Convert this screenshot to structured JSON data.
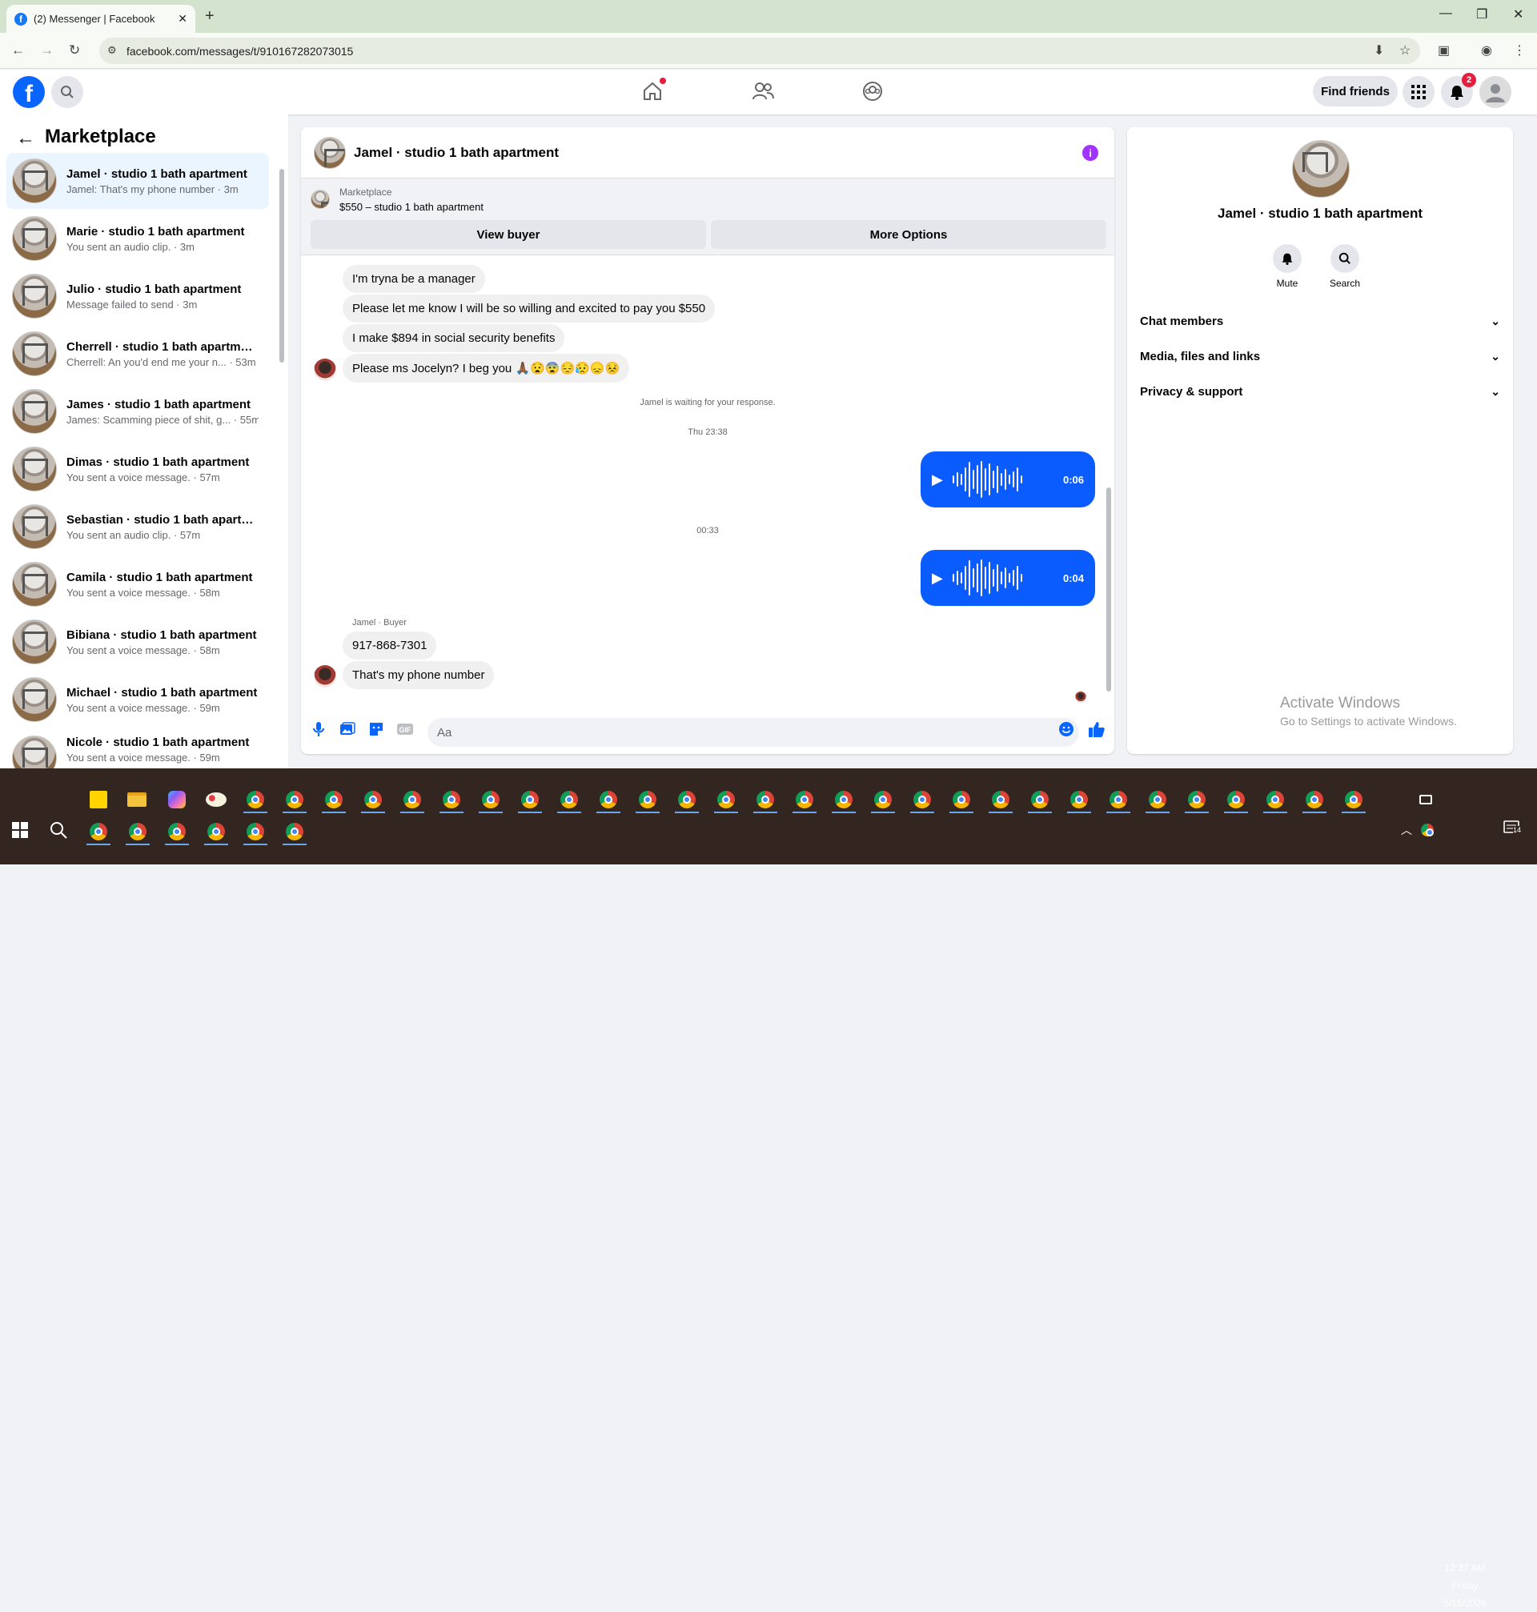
{
  "browser": {
    "tab_title": "(2) Messenger | Facebook",
    "tab_favicon": "f",
    "url": "facebook.com/messages/t/910167282073015"
  },
  "header": {
    "find_friends_label": "Find friends",
    "notifications_count": "2"
  },
  "sidebar": {
    "title": "Marketplace",
    "conversations": [
      {
        "title": "Jamel · studio 1 bath apartment",
        "snippet": "Jamel: That's my phone number · 3m"
      },
      {
        "title": "Marie · studio 1 bath apartment",
        "snippet": "You sent an audio clip. · 3m"
      },
      {
        "title": "Julio · studio 1 bath apartment",
        "snippet": "Message failed to send · 3m"
      },
      {
        "title": "Cherrell · studio 1 bath apartment",
        "snippet": "Cherrell: An you'd end me your n... · 53m"
      },
      {
        "title": "James · studio 1 bath apartment",
        "snippet": "James: Scamming piece of shit, g... · 55m"
      },
      {
        "title": "Dimas · studio 1 bath apartment",
        "snippet": "You sent a voice message. · 57m"
      },
      {
        "title": "Sebastian · studio 1 bath apartm...",
        "snippet": "You sent an audio clip. · 57m"
      },
      {
        "title": "Camila · studio 1 bath apartment",
        "snippet": "You sent a voice message. · 58m"
      },
      {
        "title": "Bibiana · studio 1 bath apartment",
        "snippet": "You sent a voice message. · 58m"
      },
      {
        "title": "Michael · studio 1 bath apartment",
        "snippet": "You sent a voice message. · 59m"
      },
      {
        "title": "Nicole · studio 1 bath apartment",
        "snippet": "You sent a voice message. · 59m"
      }
    ]
  },
  "chat": {
    "title": "Jamel · studio 1 bath apartment",
    "marketplace_category": "Marketplace",
    "listing": "$550 – studio 1 bath apartment",
    "view_buyer": "View buyer",
    "more_options": "More Options",
    "messages": [
      "I'm tryna be a manager",
      "Please let me know I will be so willing and excited to pay you $550",
      "I make $894 in social security benefits",
      "Please ms Jocelyn? I beg you 🙏🏾😧😨😔😥😞😣"
    ],
    "waiting_text": "Jamel is waiting for your response.",
    "timestamp1": "Thu 23:38",
    "voice1_duration": "0:06",
    "timestamp2": "00:33",
    "voice2_duration": "0:04",
    "sender_label": "Jamel · Buyer",
    "phone_message": "917-868-7301",
    "last_message": "That's my phone number",
    "composer_placeholder": "Aa"
  },
  "info_panel": {
    "name": "Jamel · studio 1 bath apartment",
    "mute_label": "Mute",
    "search_label": "Search",
    "sections": [
      "Chat members",
      "Media, files and links",
      "Privacy & support"
    ]
  },
  "watermark": {
    "line1": "Activate Windows",
    "line2": "Go to Settings to activate Windows."
  },
  "taskbar": {
    "time": "12:37 AM",
    "day": "Friday",
    "date": "5/15/2026",
    "notif_count": "14"
  },
  "colors": {
    "facebook_blue": "#0866ff",
    "voice_bubble": "#0b5cff",
    "info_purple": "#a033ff",
    "badge_red": "#e41e3f"
  }
}
